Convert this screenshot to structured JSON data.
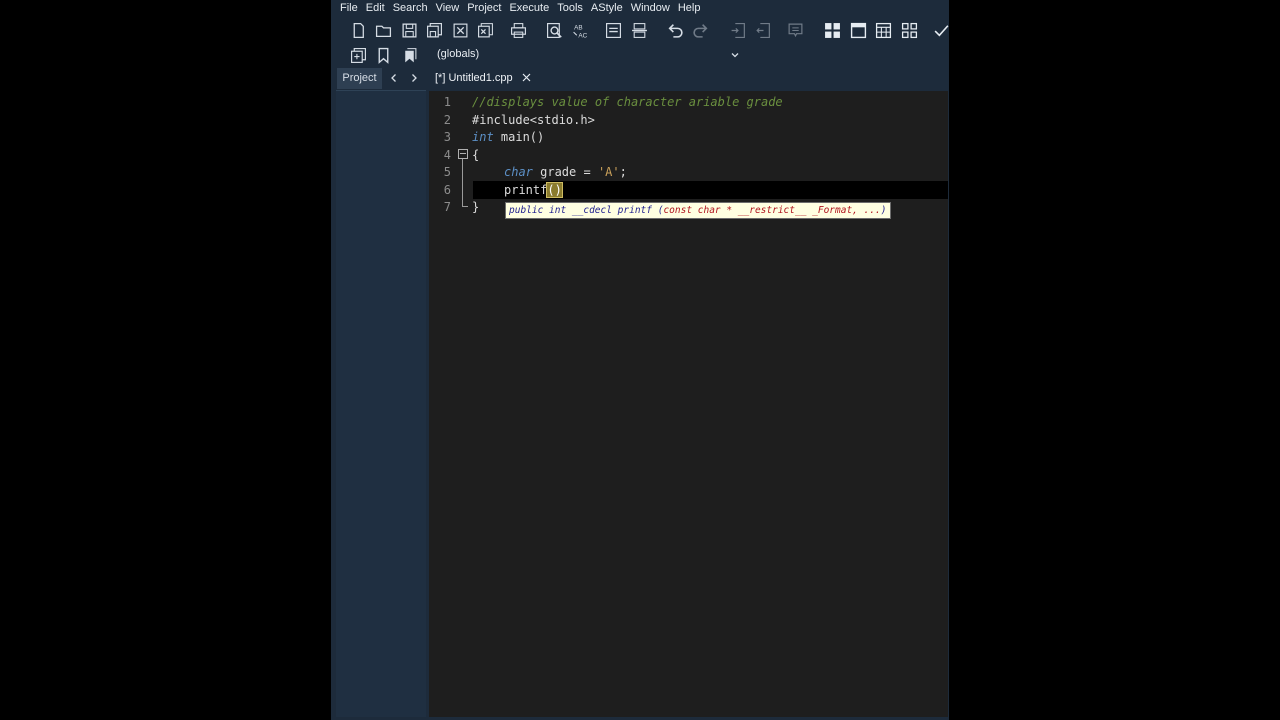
{
  "menu": [
    "File",
    "Edit",
    "Search",
    "View",
    "Project",
    "Execute",
    "Tools",
    "AStyle",
    "Window",
    "Help"
  ],
  "toolbar": {
    "icons": [
      "new-file-icon",
      "open-folder-icon",
      "save-icon",
      "save-all-icon",
      "close-icon",
      "close-all-icon",
      "print-icon",
      "find-icon",
      "replace-icon",
      "goto-icon",
      "toggle-comment-icon",
      "undo-icon",
      "redo-icon",
      "indent-icon",
      "unindent-icon",
      "bookmark-icon",
      "layout-grid-icon",
      "window-icon",
      "tile-icon",
      "layout-apps-icon",
      "check-icon"
    ],
    "scope_value": "(globals)"
  },
  "tabs": {
    "project_label": "Project",
    "file_label": "[*] Untitled1.cpp"
  },
  "editor": {
    "line_numbers": [
      "1",
      "2",
      "3",
      "4",
      "5",
      "6",
      "7"
    ],
    "line1": "//displays value of character ariable grade",
    "line2": "#include<stdio.h>",
    "line3_kw": "int",
    "line3_rest": " main()",
    "line4": "{",
    "line5_kw": "char",
    "line5_mid": " grade = ",
    "line5_str": "'A'",
    "line5_end": ";",
    "line6_fn": "printf",
    "line6_paren": "()",
    "line7": "}",
    "tooltip_left": "public int __cdecl printf (",
    "tooltip_red": "const char * __restrict__ _Format, ...",
    "tooltip_right": ")"
  },
  "colors": {
    "window_bg": "#1d2b3b",
    "editor_bg": "#1e1e1e",
    "comment": "#6a8f3f",
    "keyword": "#5c8fc5",
    "string": "#c9a05a",
    "tooltip_bg": "#ffffe1"
  }
}
